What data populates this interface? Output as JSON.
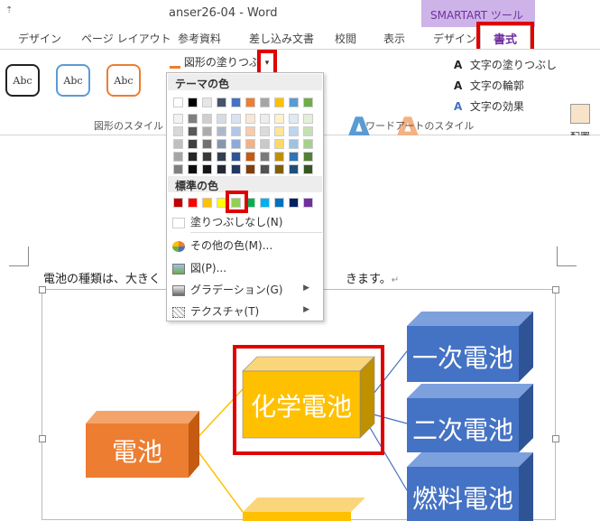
{
  "window": {
    "title": "anser26-04 - Word",
    "qat_glyph": "⇡",
    "contextual_group": "SMARTART ツール"
  },
  "tabs": [
    {
      "label": "デザイン"
    },
    {
      "label": "ページ レイアウト"
    },
    {
      "label": "参考資料"
    },
    {
      "label": "差し込み文書"
    },
    {
      "label": "校閲"
    },
    {
      "label": "表示"
    },
    {
      "label": "デザイン"
    },
    {
      "label": "書式"
    }
  ],
  "ribbon": {
    "shape_styles": {
      "buttons": [
        "Abc",
        "Abc",
        "Abc"
      ],
      "group_label": "図形のスタイル"
    },
    "shape_fill": {
      "label": "図形の塗りつぶし",
      "dropdown_glyph": "▾"
    },
    "wordart": {
      "letters": [
        "A",
        "A"
      ],
      "items": [
        {
          "label": "文字の塗りつぶし",
          "icon": "A"
        },
        {
          "label": "文字の輪郭",
          "icon": "A"
        },
        {
          "label": "文字の効果",
          "icon": "A"
        }
      ],
      "group_label": "ワードアートのスタイル"
    },
    "arrange": {
      "label": "配置"
    }
  },
  "fill_menu": {
    "theme_header": "テーマの色",
    "standard_header": "標準の色",
    "theme_top": [
      "#ffffff",
      "#000000",
      "#e7e6e6",
      "#44546a",
      "#4472c4",
      "#ed7d31",
      "#a5a5a5",
      "#ffc000",
      "#5b9bd5",
      "#70ad47"
    ],
    "theme_shades": [
      [
        "#f2f2f2",
        "#7f7f7f",
        "#d0cece",
        "#d6dce4",
        "#d9e2f3",
        "#fbe5d5",
        "#ededed",
        "#fff2cc",
        "#deeaf6",
        "#e2efd9"
      ],
      [
        "#d8d8d8",
        "#595959",
        "#aeabab",
        "#adb9ca",
        "#b4c6e7",
        "#f7cbac",
        "#dbdbdb",
        "#fee599",
        "#bdd7ee",
        "#c5e0b3"
      ],
      [
        "#bfbfbf",
        "#3f3f3f",
        "#757070",
        "#8496b0",
        "#8eaadb",
        "#f4b183",
        "#c9c9c9",
        "#ffd965",
        "#9cc3e5",
        "#a8d08d"
      ],
      [
        "#a5a5a5",
        "#262626",
        "#3a3838",
        "#323f4f",
        "#2f5496",
        "#c55a11",
        "#7b7b7b",
        "#bf9000",
        "#2e75b5",
        "#538135"
      ],
      [
        "#7f7f7f",
        "#0c0c0c",
        "#171616",
        "#222a35",
        "#1f3864",
        "#833c0b",
        "#525252",
        "#7f6000",
        "#1f4e79",
        "#375623"
      ]
    ],
    "standard_colors": [
      "#c00000",
      "#ff0000",
      "#ffc000",
      "#ffff00",
      "#92d050",
      "#00b050",
      "#00b0f0",
      "#0070c0",
      "#002060",
      "#7030a0"
    ],
    "items": [
      {
        "label": "塗りつぶしなし(N)",
        "icon": "none-icon",
        "submenu": false
      },
      {
        "label": "その他の色(M)...",
        "icon": "palette-icon",
        "submenu": false
      },
      {
        "label": "図(P)...",
        "icon": "picture-icon",
        "submenu": false
      },
      {
        "label": "グラデーション(G)",
        "icon": "gradient-icon",
        "submenu": true
      },
      {
        "label": "テクスチャ(T)",
        "icon": "texture-icon",
        "submenu": true
      }
    ],
    "submenu_glyph": "▶"
  },
  "document": {
    "text_start": "電池の種類は、大きく",
    "text_end": "きます。",
    "pilcrow": "↵",
    "smartart": {
      "root": "電池",
      "middle": "化学電池",
      "children": [
        "一次電池",
        "二次電池",
        "燃料電池"
      ]
    }
  },
  "colors": {
    "accent_purple": "#7030a0",
    "highlight_red": "#e00000",
    "orange": "#ed7d31",
    "gold": "#ffc000",
    "blue": "#4472c4"
  }
}
